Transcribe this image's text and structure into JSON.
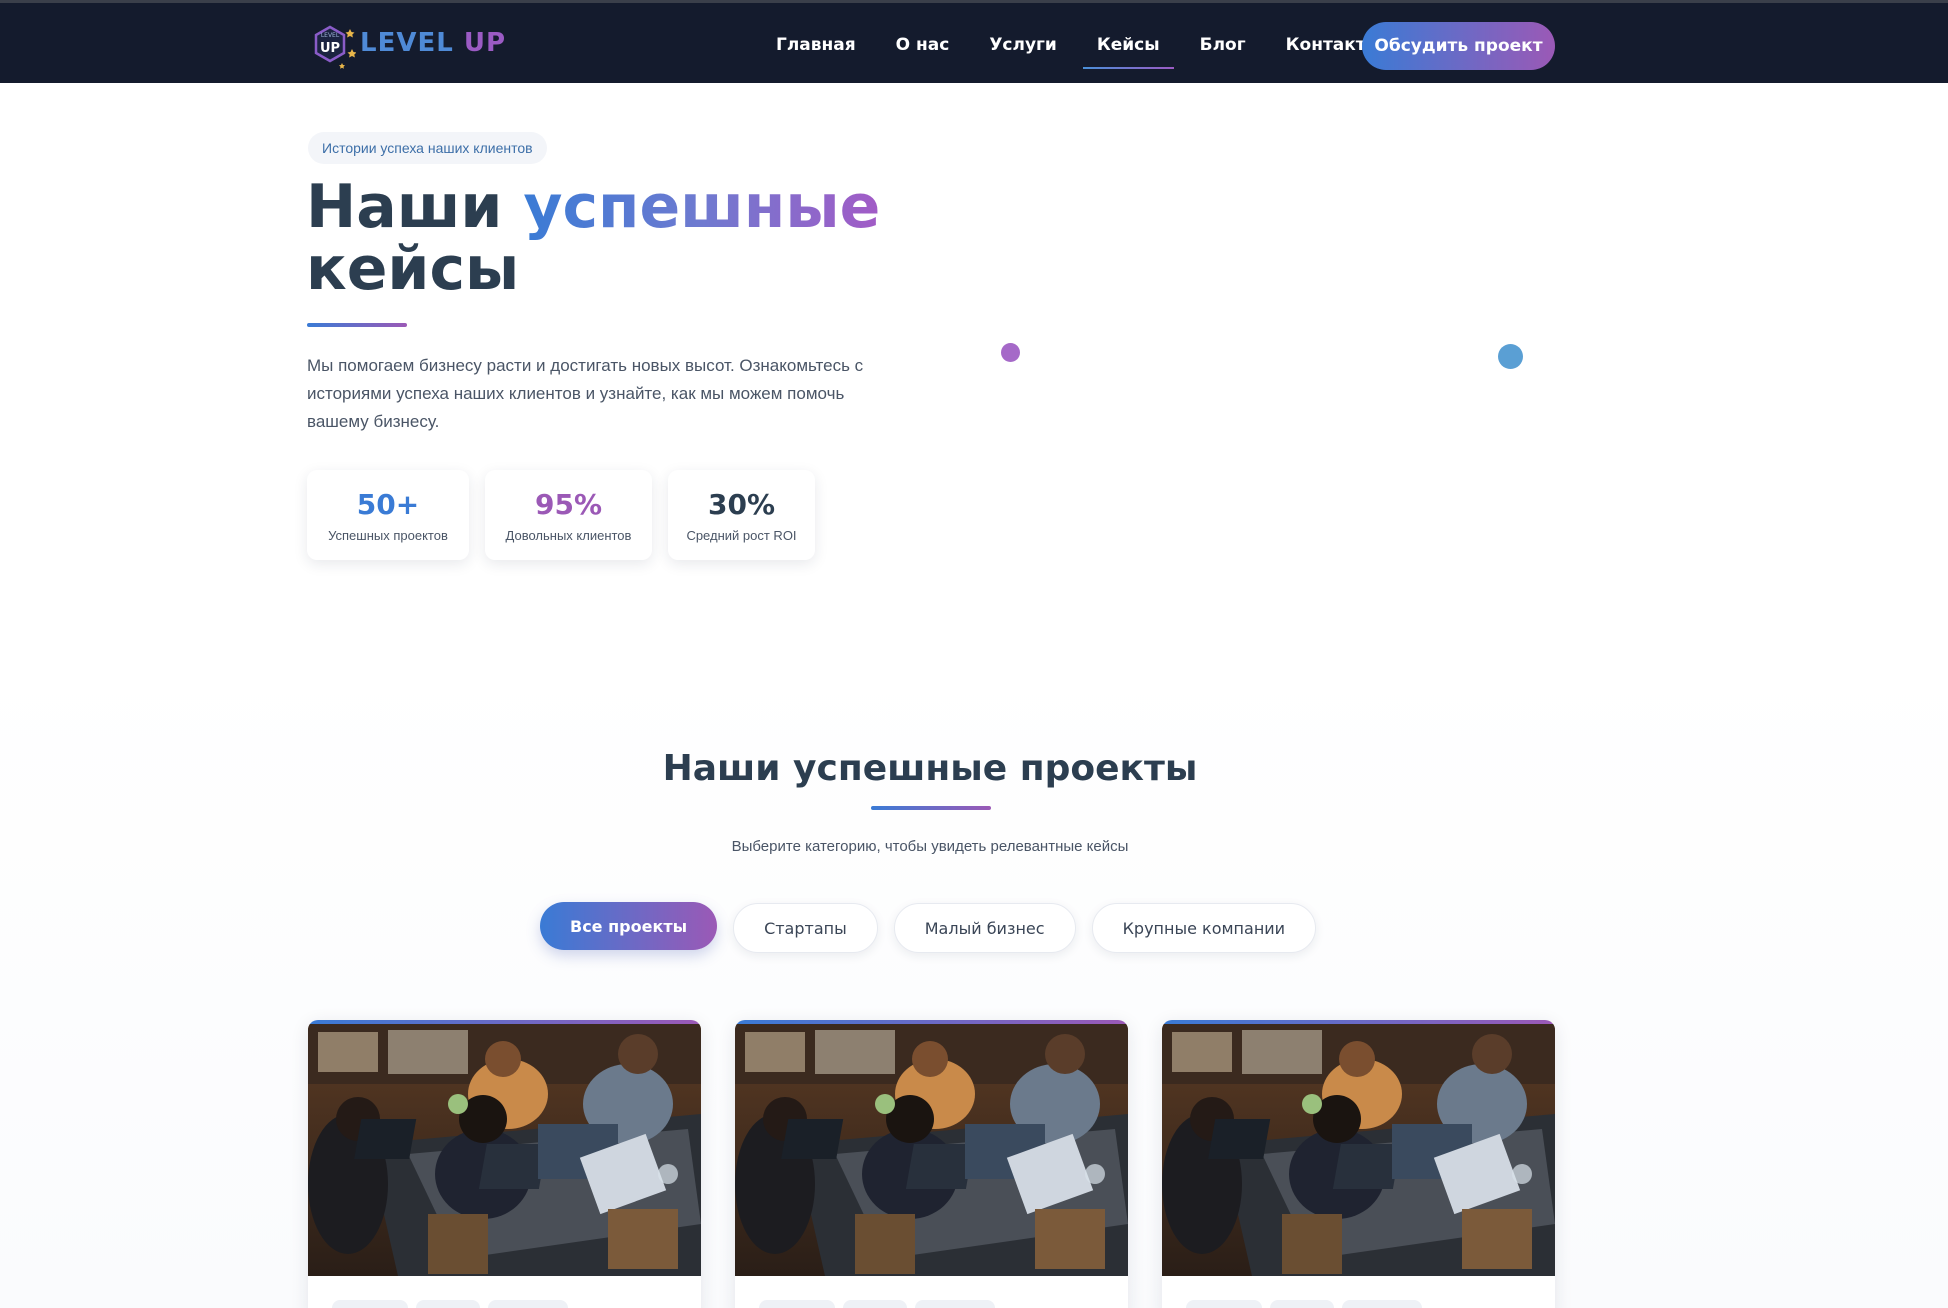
{
  "header": {
    "logo_badge": "UP",
    "logo_badge_small": "LEVEL",
    "logo_word1": "LEVEL",
    "logo_word2": "UP",
    "nav": [
      {
        "label": "Главная",
        "active": false
      },
      {
        "label": "О нас",
        "active": false
      },
      {
        "label": "Услуги",
        "active": false
      },
      {
        "label": "Кейсы",
        "active": true
      },
      {
        "label": "Блог",
        "active": false
      },
      {
        "label": "Контакты",
        "active": false
      }
    ],
    "cta_label": "Обсудить проект"
  },
  "hero": {
    "tag": "Истории успеха наших клиентов",
    "title_part1": "Наши ",
    "title_highlight": "успешные",
    "title_part2": "кейсы",
    "description": "Мы помогаем бизнесу расти и достигать новых высот. Ознакомьтесь с историями успеха наших клиентов и узнайте, как мы можем помочь вашему бизнесу.",
    "stats": [
      {
        "value": "50+",
        "label": "Успешных проектов",
        "color": "#3a7bd5"
      },
      {
        "value": "95%",
        "label": "Довольных клиентов",
        "color": "#9b59b6"
      },
      {
        "value": "30%",
        "label": "Средний рост ROI",
        "color": "#2c3e50"
      }
    ]
  },
  "projects": {
    "title": "Наши успешные проекты",
    "subtitle": "Выберите категорию, чтобы увидеть релевантные кейсы",
    "filters": [
      {
        "label": "Все проекты",
        "active": true
      },
      {
        "label": "Стартапы",
        "active": false
      },
      {
        "label": "Малый бизнес",
        "active": false
      },
      {
        "label": "Крупные компании",
        "active": false
      }
    ],
    "cards": [
      {
        "image": "team-working-on-laptops-photo"
      },
      {
        "image": "team-working-on-laptops-photo"
      },
      {
        "image": "team-working-on-laptops-photo"
      }
    ]
  },
  "colors": {
    "header_bg": "#141b2d",
    "accent_blue": "#3a7bd5",
    "accent_purple": "#9b59b6",
    "heading": "#2c3e50"
  }
}
